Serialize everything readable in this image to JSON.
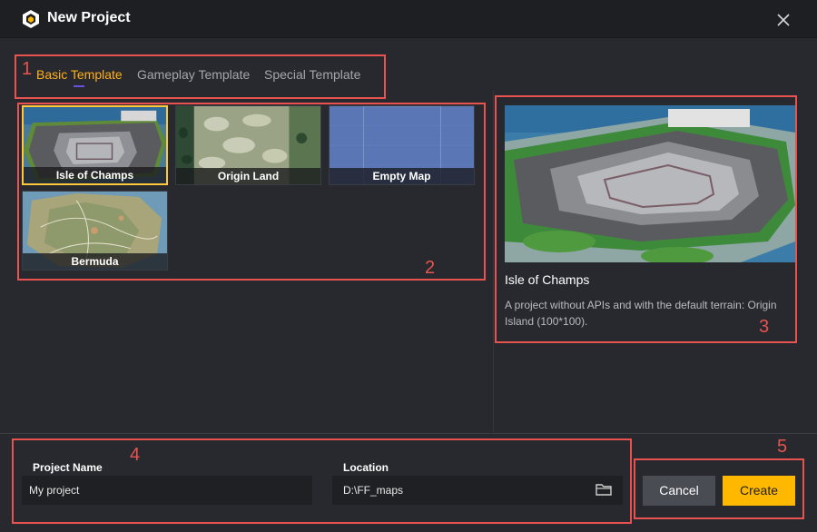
{
  "window": {
    "title": "New Project",
    "logo_icon": "app-logo-icon",
    "close_icon": "close-icon"
  },
  "tabs": [
    {
      "label": "Basic Template",
      "active": true
    },
    {
      "label": "Gameplay Template",
      "active": false
    },
    {
      "label": "Special Template",
      "active": false
    }
  ],
  "templates": [
    {
      "name": "Isle of Champs",
      "selected": true
    },
    {
      "name": "Origin Land",
      "selected": false
    },
    {
      "name": "Empty Map",
      "selected": false
    },
    {
      "name": "Bermuda",
      "selected": false
    }
  ],
  "preview": {
    "title": "Isle of Champs",
    "description": "A project without APIs and with the default terrain: Origin Island (100*100)."
  },
  "form": {
    "project_name_label": "Project Name",
    "project_name_value": "My project",
    "location_label": "Location",
    "location_value": "D:\\FF_maps",
    "folder_icon": "folder-icon"
  },
  "buttons": {
    "cancel": "Cancel",
    "create": "Create"
  },
  "annotations": [
    "1",
    "2",
    "3",
    "4",
    "5"
  ],
  "colors": {
    "accent": "#ffb800",
    "active_tab": "#ffb11a",
    "annotation": "#e8534f",
    "tab_underline": "#6a4ee0"
  }
}
